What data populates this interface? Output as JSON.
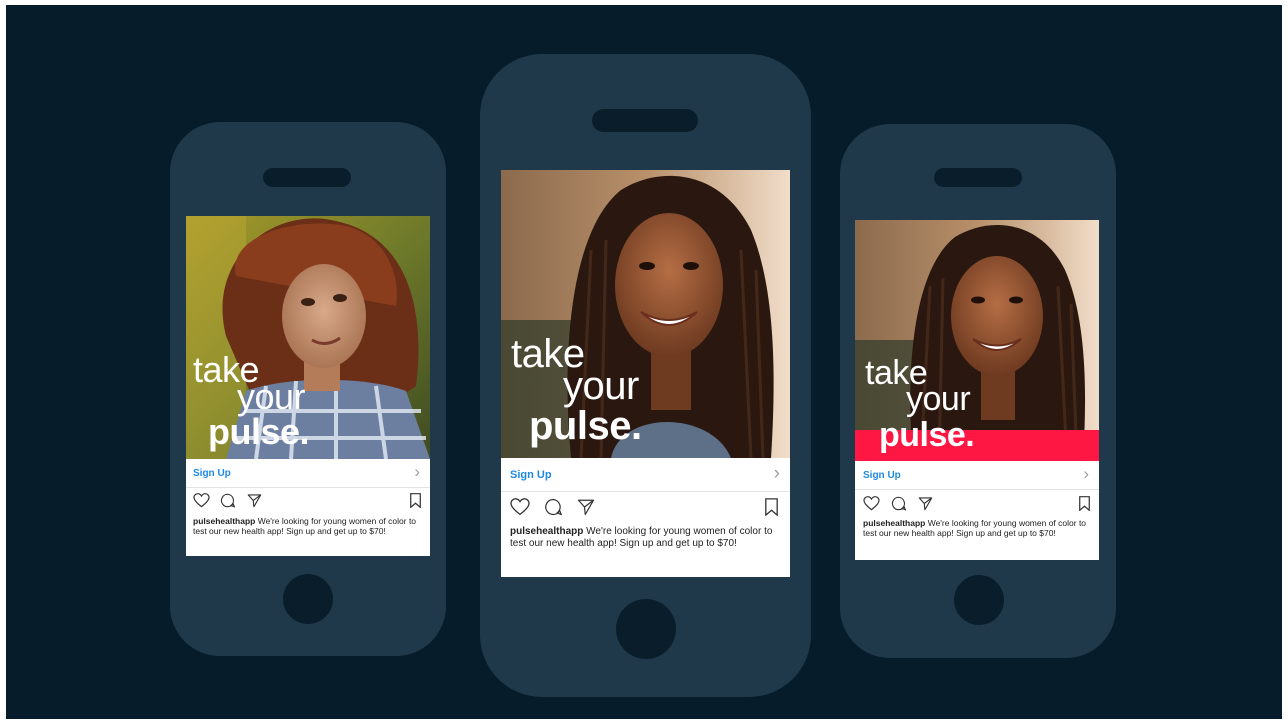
{
  "background_color": "#071c2b",
  "phone_color": "#1f394b",
  "accent_red": "#ff1744",
  "link_color": "#1f8ae6",
  "ads": [
    {
      "headline_line1": "take",
      "headline_line2": "your",
      "headline_line3": "pulse.",
      "cta_label": "Sign Up",
      "cta_chevron": "›",
      "icons": [
        "heart-icon",
        "comment-icon",
        "share-icon",
        "bookmark-icon"
      ],
      "caption_user": "pulsehealthapp",
      "caption_text": " We're looking for young women of color to test our new health app! Sign up and get up to $70!"
    },
    {
      "headline_line1": "take",
      "headline_line2": "your",
      "headline_line3": "pulse.",
      "cta_label": "Sign Up",
      "cta_chevron": "›",
      "icons": [
        "heart-icon",
        "comment-icon",
        "share-icon",
        "bookmark-icon"
      ],
      "caption_user": "pulsehealthapp",
      "caption_text": " We're looking for young women of color to test our new health app! Sign up and get up to $70!"
    },
    {
      "headline_line1": "take",
      "headline_line2": "your",
      "headline_line3": "pulse.",
      "cta_label": "Sign Up",
      "cta_chevron": "›",
      "icons": [
        "heart-icon",
        "comment-icon",
        "share-icon",
        "bookmark-icon"
      ],
      "caption_user": "pulsehealthapp",
      "caption_text": " We're looking for young women of color to test our new health app! Sign up and get up to $70!"
    }
  ]
}
